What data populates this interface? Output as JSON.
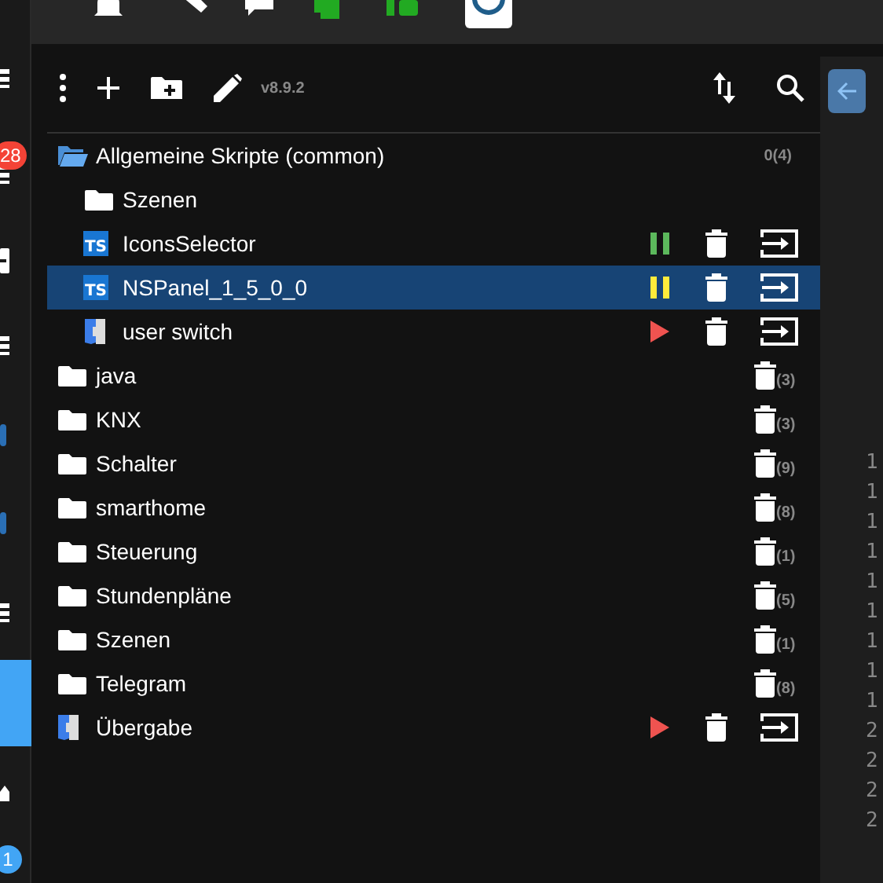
{
  "rail": {
    "badges": [
      {
        "text": "28",
        "color": "#f44336"
      },
      {
        "text": "1",
        "color": "#42a5f5"
      }
    ]
  },
  "toolbar": {
    "version": "v8.9.2"
  },
  "tree": [
    {
      "kind": "folder",
      "label": "Allgemeine Skripte (common)",
      "expanded": true,
      "count": "0(4)",
      "children": [
        {
          "kind": "folder",
          "label": "Szenen",
          "expanded": false
        },
        {
          "kind": "ts",
          "badge": "TS",
          "label": "IconsSelector",
          "running": true,
          "color": "#5cb85c",
          "selected": false
        },
        {
          "kind": "ts",
          "badge": "TS",
          "label": "NSPanel_1_5_0_0",
          "running": true,
          "color": "#ffeb3b",
          "selected": true
        },
        {
          "kind": "blockly",
          "label": "user switch",
          "running": false,
          "color": "#ef5350",
          "selected": false
        }
      ]
    },
    {
      "kind": "folder",
      "label": "java",
      "expanded": false,
      "count": "(3)"
    },
    {
      "kind": "folder",
      "label": "KNX",
      "expanded": false,
      "count": "(3)"
    },
    {
      "kind": "folder",
      "label": "Schalter",
      "expanded": false,
      "count": "(9)"
    },
    {
      "kind": "folder",
      "label": "smarthome",
      "expanded": false,
      "count": "(8)"
    },
    {
      "kind": "folder",
      "label": "Steuerung",
      "expanded": false,
      "count": "(1)"
    },
    {
      "kind": "folder",
      "label": "Stundenpläne",
      "expanded": false,
      "count": "(5)"
    },
    {
      "kind": "folder",
      "label": "Szenen",
      "expanded": false,
      "count": "(1)"
    },
    {
      "kind": "folder",
      "label": "Telegram",
      "expanded": false,
      "count": "(8)"
    },
    {
      "kind": "blockly",
      "label": "Übergabe",
      "running": false,
      "color": "#ef5350",
      "selected": false
    }
  ],
  "editor": {
    "line_numbers": [
      "1",
      "1",
      "1",
      "1",
      "1",
      "1",
      "1",
      "1",
      "1",
      "2",
      "2",
      "2",
      "2"
    ]
  }
}
